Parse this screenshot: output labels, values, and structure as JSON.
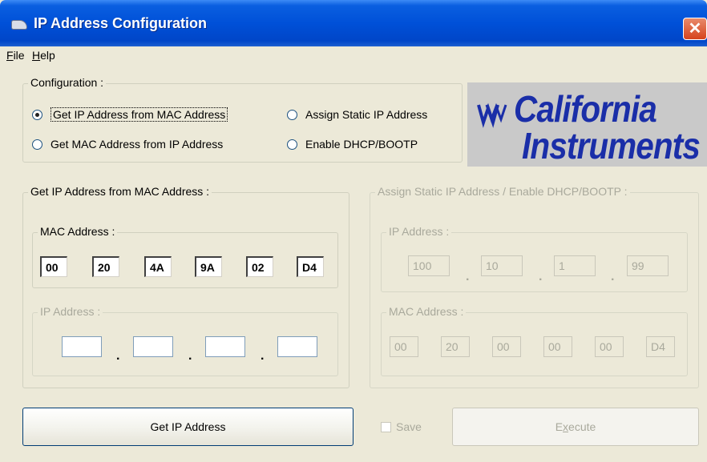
{
  "window": {
    "title": "IP Address Configuration",
    "close_label": "✕"
  },
  "menu": [
    {
      "accel": "F",
      "rest": "ile"
    },
    {
      "accel": "H",
      "rest": "elp"
    }
  ],
  "configuration": {
    "legend": "Configuration :",
    "options": [
      {
        "label": "Get IP Address from MAC Address",
        "selected": true
      },
      {
        "label": "Get MAC Address from IP Address",
        "selected": false
      },
      {
        "label": "Assign Static IP Address",
        "selected": false
      },
      {
        "label": "Enable DHCP/BOOTP",
        "selected": false
      }
    ]
  },
  "logo": {
    "line1": "California",
    "line2": "Instruments",
    "color": "#1a2ea8"
  },
  "get_ip_group": {
    "legend": "Get IP Address from MAC Address :",
    "mac_legend": "MAC Address :",
    "mac_octets": [
      "00",
      "20",
      "4A",
      "9A",
      "02",
      "D4"
    ],
    "ip_legend": "IP Address :",
    "ip_octets": [
      "",
      "",
      "",
      ""
    ],
    "separator": "."
  },
  "static_group": {
    "legend": "Assign Static IP Address / Enable DHCP/BOOTP :",
    "ip_legend": "IP Address :",
    "ip_octets": [
      "100",
      "10",
      "1",
      "99"
    ],
    "mac_legend": "MAC Address :",
    "mac_octets": [
      "00",
      "20",
      "00",
      "00",
      "00",
      "D4"
    ],
    "separator": "."
  },
  "buttons": {
    "get_ip": "Get IP Address",
    "save": "Save",
    "execute_accel": "x",
    "execute_pre": "E",
    "execute_post": "ecute"
  }
}
